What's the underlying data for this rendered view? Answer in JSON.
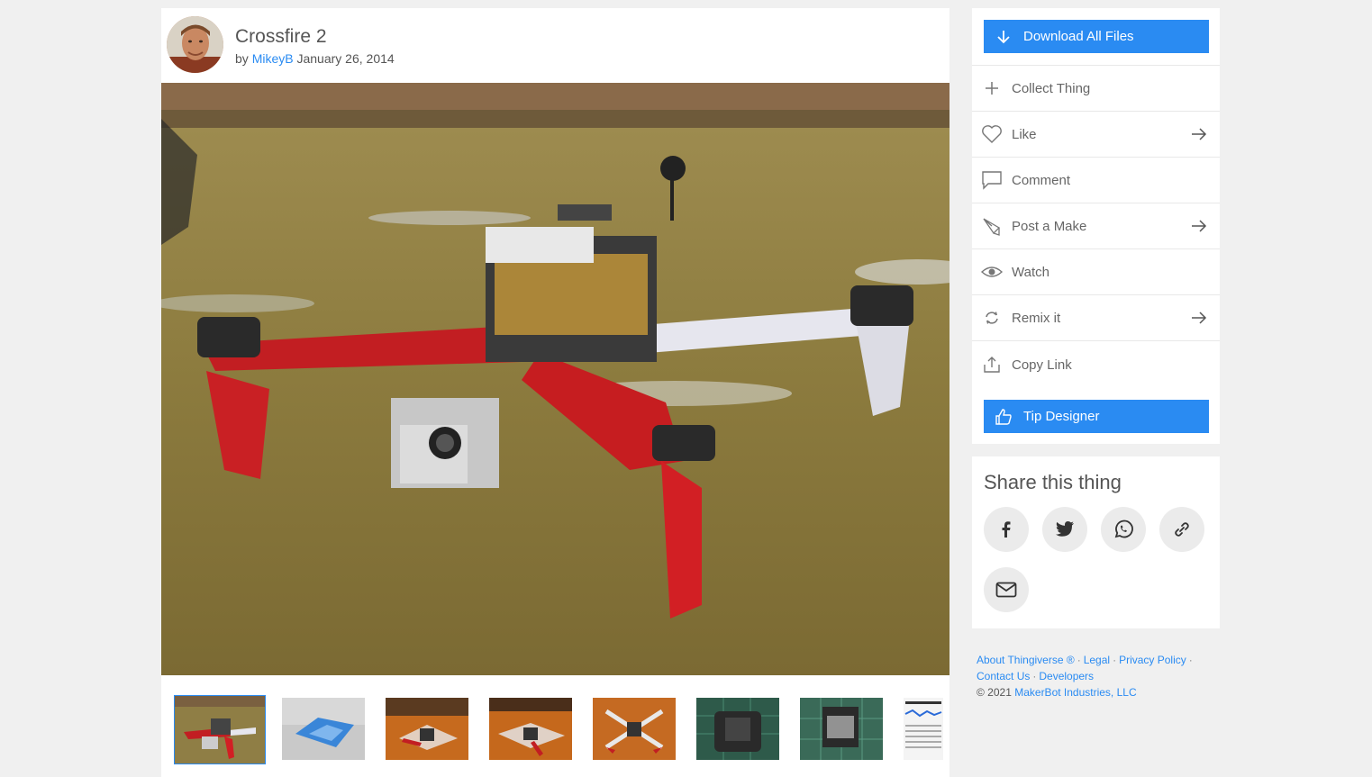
{
  "thing": {
    "title": "Crossfire 2",
    "by_label": "by",
    "author": "MikeyB",
    "date": "January 26, 2014"
  },
  "actions": {
    "download_label": "Download All Files",
    "collect_label": "Collect Thing",
    "like_label": "Like",
    "comment_label": "Comment",
    "post_make_label": "Post a Make",
    "watch_label": "Watch",
    "remix_label": "Remix it",
    "copy_link_label": "Copy Link",
    "tip_label": "Tip Designer"
  },
  "share": {
    "title": "Share this thing",
    "buttons": [
      "facebook-icon",
      "twitter-icon",
      "whatsapp-icon",
      "link-icon",
      "email-icon"
    ]
  },
  "footer": {
    "about": "About Thingiverse ®",
    "legal": "Legal",
    "privacy": "Privacy Policy",
    "contact": "Contact Us",
    "developers": "Developers",
    "copyright_prefix": "©  2021",
    "company": "MakerBot Industries, LLC",
    "separator": "·"
  },
  "colors": {
    "accent": "#2a8bf2",
    "background": "#f0f0f0"
  }
}
